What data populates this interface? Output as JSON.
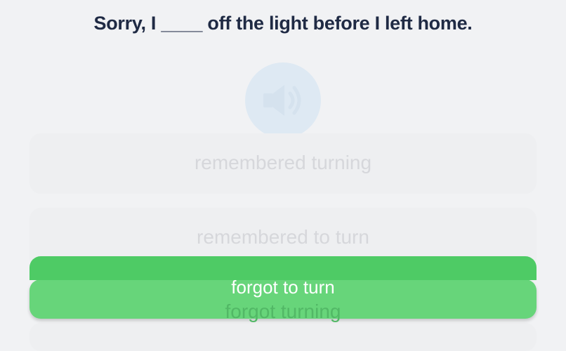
{
  "question": {
    "text": "Sorry, I ____ off the light before I left home."
  },
  "audio": {
    "icon": "speaker-icon"
  },
  "options": [
    {
      "label": "remembered turning"
    },
    {
      "label": "remembered to turn"
    },
    {
      "label": "forgot to turn"
    },
    {
      "label": "forgot turning"
    }
  ],
  "selected": {
    "label": "forgot to turn"
  },
  "colors": {
    "background": "#f1f2f4",
    "option_bg": "#eeeff1",
    "selected_green": "#4ecb65",
    "green_light": "#67d57a",
    "question_text": "#1f2a44",
    "audio_bg": "#dde9f3"
  }
}
